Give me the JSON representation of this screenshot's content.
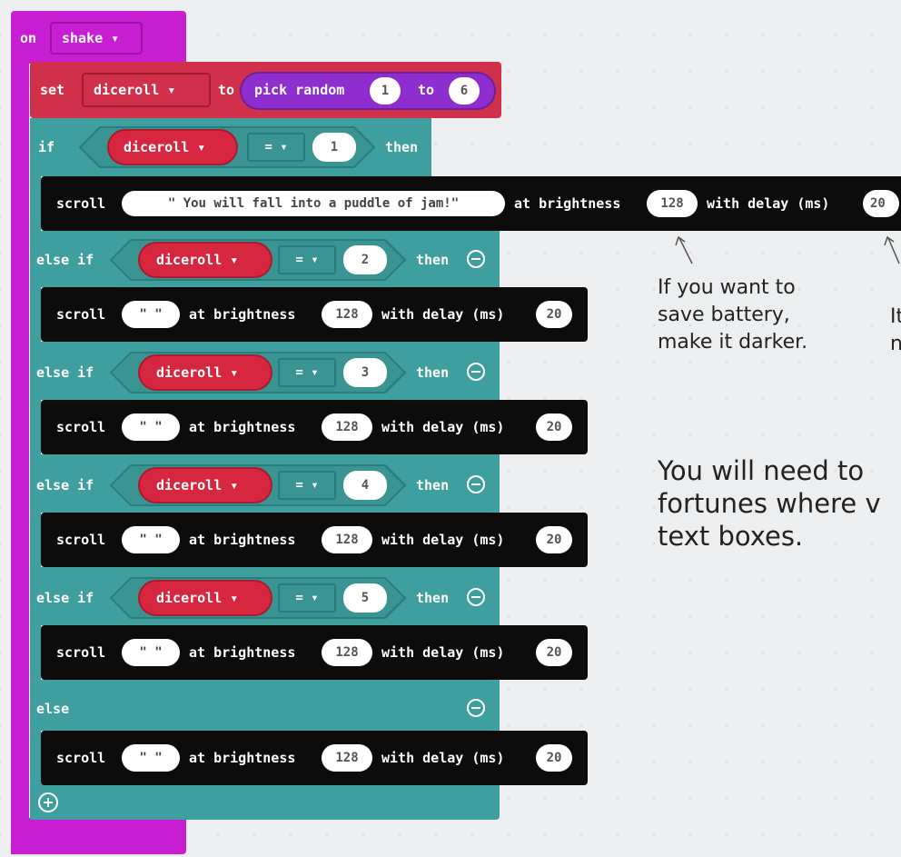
{
  "event_block": {
    "keyword": "on",
    "event": "shake ▾"
  },
  "set_block": {
    "keyword": "set",
    "variable": "diceroll ▾",
    "to": "to",
    "random_label": "pick random",
    "min": "1",
    "range_to": "to",
    "max": "6"
  },
  "if_chain": {
    "if_label": "if",
    "else_if_label": "else if",
    "else_label": "else",
    "then_label": "then",
    "variable": "diceroll ▾",
    "operator": "= ▾",
    "conditions": [
      "1",
      "2",
      "3",
      "4",
      "5"
    ]
  },
  "scroll_blocks": {
    "keyword": "scroll",
    "brightness_label": "at brightness",
    "delay_label": "with delay (ms)",
    "first_text": "\" You will fall into a puddle of jam!\"",
    "empty_text": "\" \"",
    "brightness": "128",
    "delay": "20"
  },
  "notes": {
    "brightness_note": "If you want to\nsave battery,\nmake it darker.",
    "delay_note": "It\nn",
    "main_note": "You will need to\nfortunes where v\ntext boxes."
  },
  "colors": {
    "event": "#c71ed2",
    "variable": "#d0304a",
    "logic": "#3f9e9e",
    "basic": "#0c0c0c",
    "math": "#8e2ecf"
  }
}
